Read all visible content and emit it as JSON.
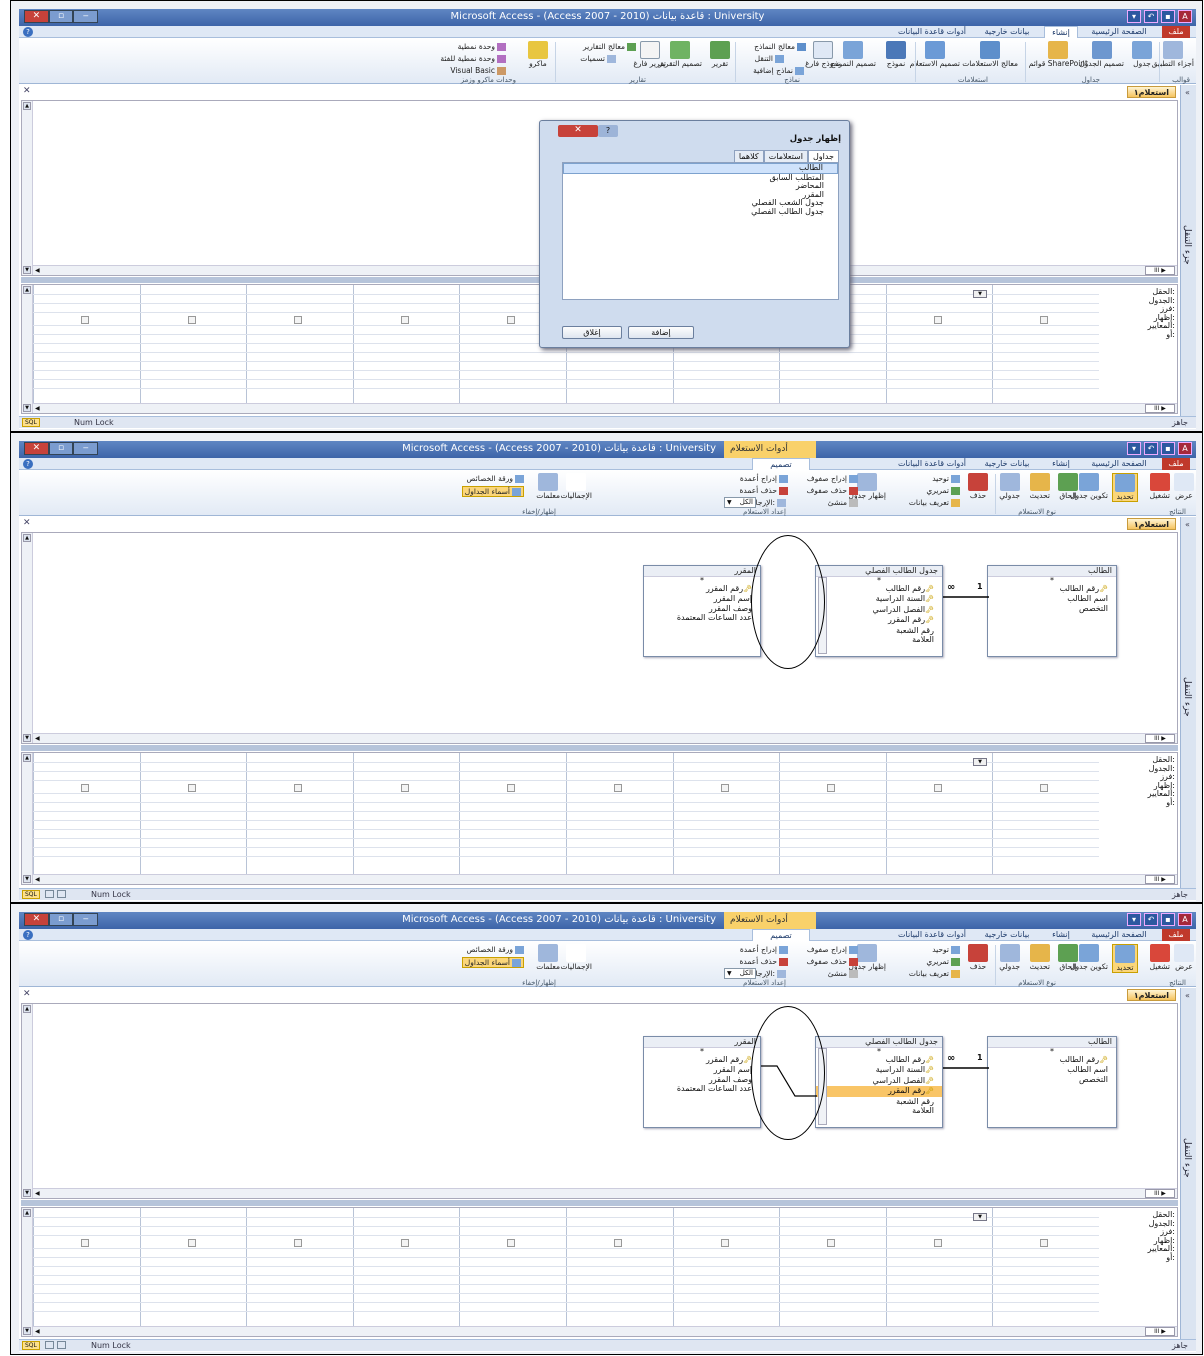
{
  "app": {
    "title_1": "Microsoft Access - (Access 2007 - 2010) قاعدة بيانات : University",
    "title_2": "Microsoft Access - (Access 2007 - 2010) قاعدة بيانات : University",
    "context_tab": "أدوات الاستعلام"
  },
  "tabs1": [
    "ملف",
    "الصفحة الرئيسية",
    "إنشاء",
    "بيانات خارجية",
    "أدوات قاعدة البيانات"
  ],
  "tabs2": [
    "ملف",
    "الصفحة الرئيسية",
    "إنشاء",
    "بيانات خارجية",
    "أدوات قاعدة البيانات",
    "تصميم"
  ],
  "ribbon_create": {
    "buttons": [
      "أجزاء التطبيق",
      "جدول",
      "تصميم الجدول",
      "قوائم SharePoint",
      "معالج الاستعلامات",
      "تصميم الاستعلام",
      "نموذج",
      "تصميم النموذج",
      "نموذج فارغ",
      "تقرير",
      "تصميم التقرير",
      "تقرير فارغ",
      "ماكرو"
    ],
    "small": [
      "معالج النماذج",
      "التنقل",
      "نماذج إضافية",
      "معالج التقارير",
      "تسميات",
      "وحدة نمطية",
      "وحدة نمطية للفئة",
      "Visual Basic"
    ],
    "groups": [
      "قوالب",
      "جداول",
      "استعلامات",
      "نماذج",
      "تقارير",
      "وحدات ماكرو وزمز"
    ]
  },
  "ribbon_design": {
    "buttons": [
      "عرض",
      "تشغيل",
      "تحديد",
      "تكوين جدول",
      "إلحاق",
      "تحديث",
      "جدولي",
      "حذف",
      "إظهار جدول",
      "الإجماليات",
      "معلمات"
    ],
    "small": [
      "توحيد",
      "تمريري",
      "تعريف بيانات",
      "إدراج صفوف",
      "حذف صفوف",
      "منشئ",
      "إدراج أعمدة",
      "حذف أعمدة",
      "الإرجاع:",
      "الكل",
      "ورقة الخصائص",
      "أسماء الجداول"
    ],
    "groups": [
      "النتائج",
      "نوع الاستعلام",
      "إعداد الاستعلام",
      "إظهار/إخفاء"
    ]
  },
  "nav_pane_label": "جزء التنقل",
  "object_tab": "استعلام١",
  "row_labels": [
    "الحقل:",
    "الجدول:",
    "فرز:",
    "إظهار:",
    "المعايير:",
    "أو:"
  ],
  "status": {
    "sql": "SQL",
    "num_lock": "Num Lock",
    "ready": "جاهز"
  },
  "dialog": {
    "title": "إظهار جدول",
    "tabs": [
      "جداول",
      "استعلامات",
      "كلاهما"
    ],
    "items": [
      "الطالب",
      "المتطلب السابق",
      "المحاضر",
      "المقرر",
      "جدول الشعب الفصلي",
      "جدول الطالب الفصلي"
    ],
    "add": "إضافة",
    "close": "إغلاق"
  },
  "tables": {
    "student": {
      "name": "الطالب",
      "fields": [
        "رقم الطالب",
        "اسم الطالب",
        "التخصص"
      ]
    },
    "enroll": {
      "name": "جدول الطالب الفصلي",
      "fields": [
        "رقم الطالب",
        "السنة الدراسية",
        "الفصل الدراسي",
        "رقم المقرر",
        "رقم الشعبة",
        "العلامة"
      ]
    },
    "course": {
      "name": "المقرر",
      "fields": [
        "رقم المقرر",
        "إسم المقرر",
        "وصف المقرر",
        "عدد الساعات المعتمدة"
      ]
    },
    "rel_one": "1",
    "rel_many": "∞"
  }
}
